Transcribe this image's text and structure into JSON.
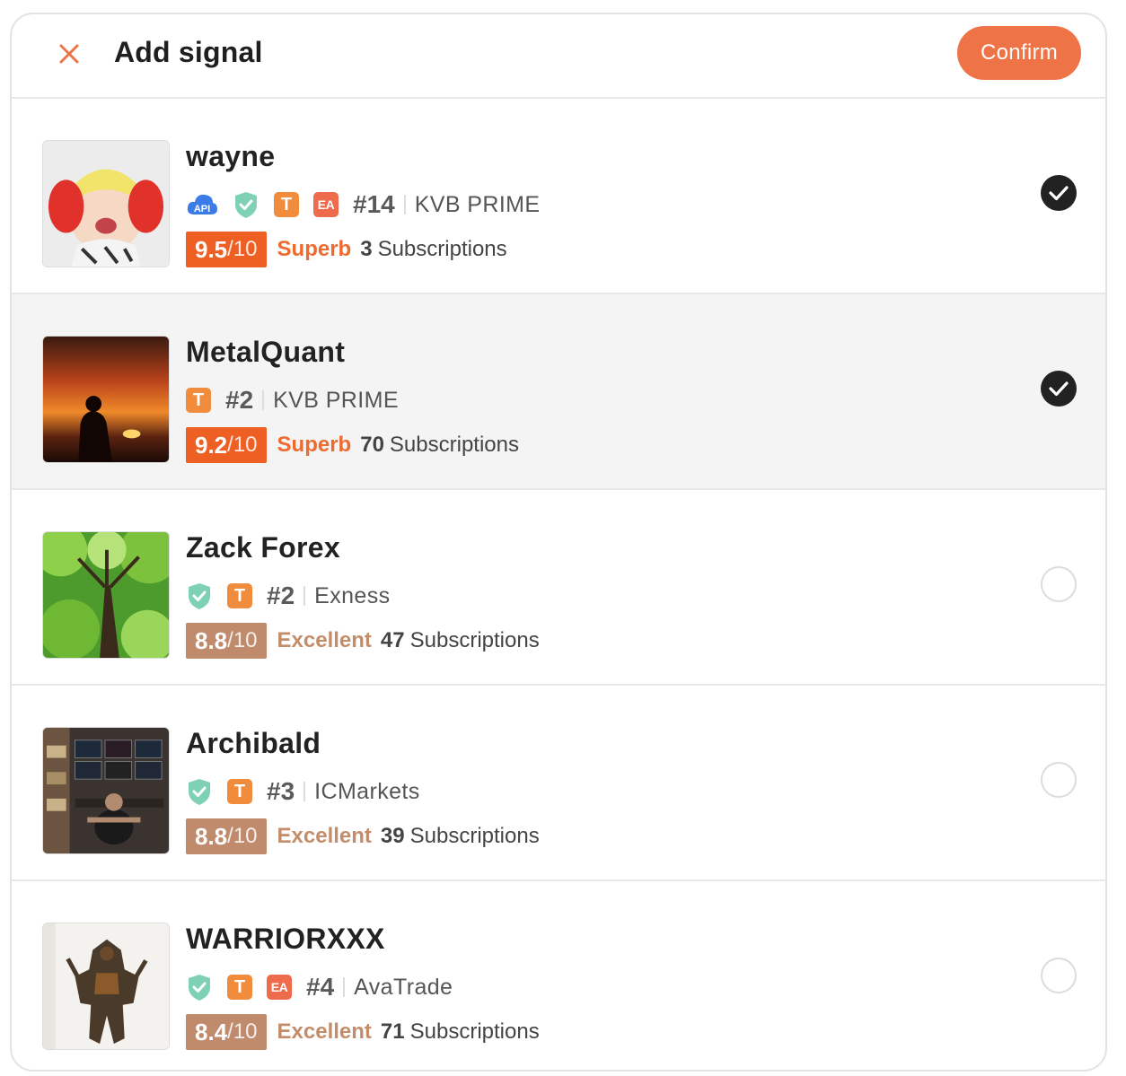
{
  "header": {
    "title": "Add signal",
    "confirm_label": "Confirm"
  },
  "colors": {
    "accent": "#ee7447",
    "superb": "#ee5f23",
    "excellent": "#c08b6c"
  },
  "signals": [
    {
      "name": "wayne",
      "badges": [
        "api-icon",
        "shield-check-icon",
        "T",
        "EA"
      ],
      "rank": "#14",
      "broker": "KVB PRIME",
      "score": "9.5",
      "score_max": "/10",
      "grade": "Superb",
      "subscriptions_count": "3",
      "subscriptions_label": "Subscriptions",
      "selected": true,
      "avatar": "baby-photo"
    },
    {
      "name": "MetalQuant",
      "badges": [
        "T"
      ],
      "rank": "#2",
      "broker": "KVB PRIME",
      "score": "9.2",
      "score_max": "/10",
      "grade": "Superb",
      "subscriptions_count": "70",
      "subscriptions_label": "Subscriptions",
      "selected": true,
      "avatar": "sunset-photo"
    },
    {
      "name": "Zack Forex",
      "badges": [
        "shield-check-icon",
        "T"
      ],
      "rank": "#2",
      "broker": "Exness",
      "score": "8.8",
      "score_max": "/10",
      "grade": "Excellent",
      "subscriptions_count": "47",
      "subscriptions_label": "Subscriptions",
      "selected": false,
      "avatar": "tree-photo"
    },
    {
      "name": "Archibald",
      "badges": [
        "shield-check-icon",
        "T"
      ],
      "rank": "#3",
      "broker": "ICMarkets",
      "score": "8.8",
      "score_max": "/10",
      "grade": "Excellent",
      "subscriptions_count": "39",
      "subscriptions_label": "Subscriptions",
      "selected": false,
      "avatar": "trading-desk-photo"
    },
    {
      "name": "WARRIORXXX",
      "badges": [
        "shield-check-icon",
        "T",
        "EA"
      ],
      "rank": "#4",
      "broker": "AvaTrade",
      "score": "8.4",
      "score_max": "/10",
      "grade": "Excellent",
      "subscriptions_count": "71",
      "subscriptions_label": "Subscriptions",
      "selected": false,
      "avatar": "warrior-art"
    }
  ]
}
